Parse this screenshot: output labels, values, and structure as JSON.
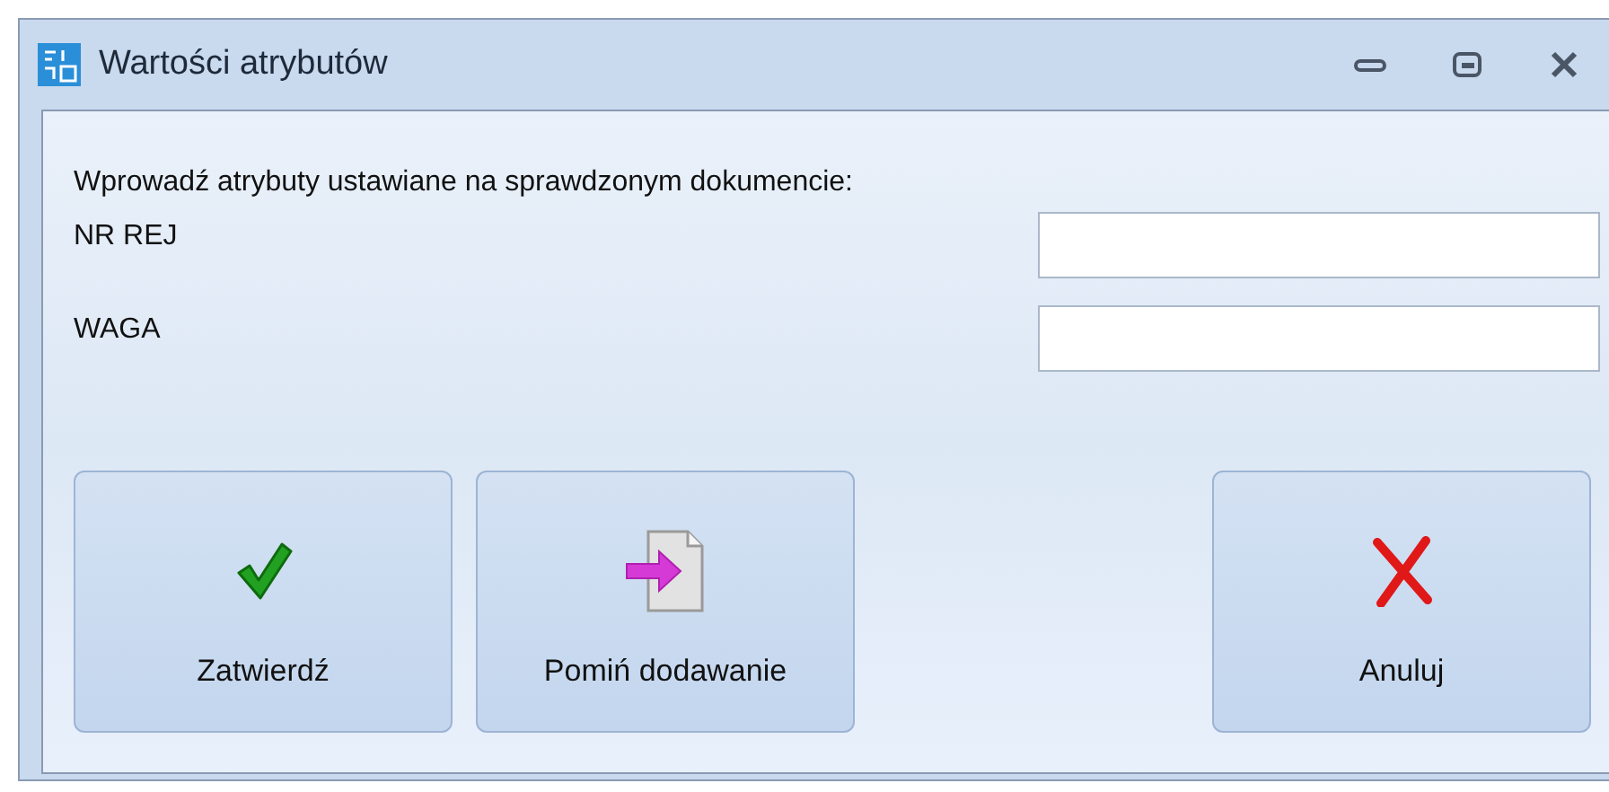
{
  "window": {
    "title": "Wartości atrybutów"
  },
  "prompt": "Wprowadź atrybuty ustawiane na sprawdzonym dokumencie:",
  "fields": [
    {
      "label": "NR REJ"
    },
    {
      "label": "WAGA"
    }
  ],
  "buttons": [
    {
      "label": "Zatwierdź",
      "kind": "confirm"
    },
    {
      "label": "Pomiń dodawanie",
      "kind": "skip"
    },
    {
      "label": "Anuluj",
      "kind": "cancel"
    }
  ]
}
